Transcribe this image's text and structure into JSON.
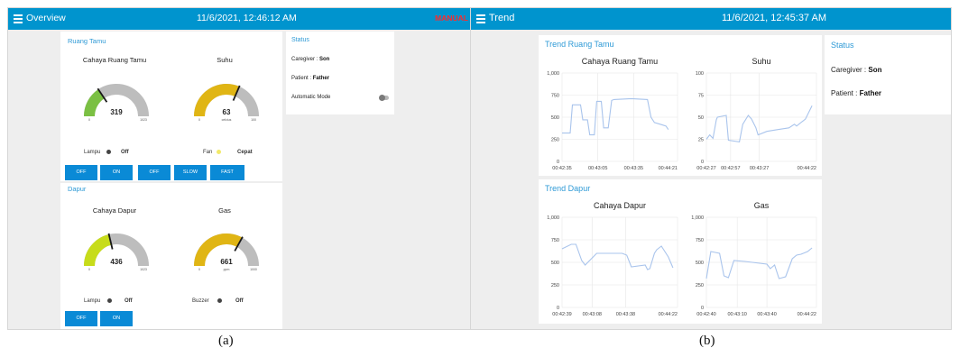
{
  "a": {
    "header": {
      "title": "Overview",
      "time": "11/6/2021, 12:46:12 AM",
      "mode": "MANUAL"
    },
    "ruang_tamu": {
      "group_title": "Ruang Tamu",
      "gauges": [
        {
          "title": "Cahaya Ruang Tamu",
          "value": 319,
          "min": 0,
          "max": 1023,
          "min_label": "0",
          "max_label": "1023",
          "unit": "",
          "color": "#7bc043"
        },
        {
          "title": "Suhu",
          "value": 63,
          "min": 0,
          "max": 100,
          "min_label": "0",
          "max_label": "100",
          "unit": "celcius",
          "color": "#e0b514"
        }
      ],
      "lampu": {
        "label": "Lampu",
        "state": "Off"
      },
      "fan": {
        "label": "Fan",
        "state": "Cepat"
      },
      "buttons": [
        "OFF",
        "ON",
        "OFF",
        "SLOW",
        "FAST"
      ]
    },
    "dapur": {
      "group_title": "Dapur",
      "gauges": [
        {
          "title": "Cahaya Dapur",
          "value": 436,
          "min": 0,
          "max": 1023,
          "min_label": "0",
          "max_label": "1023",
          "unit": "",
          "color": "#c7dc1a"
        },
        {
          "title": "Gas",
          "value": 661,
          "min": 0,
          "max": 1000,
          "min_label": "0",
          "max_label": "1000",
          "unit": "ppm",
          "color": "#e0b514"
        }
      ],
      "lampu": {
        "label": "Lampu",
        "state": "Off"
      },
      "buzzer": {
        "label": "Buzzer",
        "state": "Off"
      },
      "buttons": [
        "OFF",
        "ON"
      ]
    },
    "status": {
      "title": "Status",
      "caregiver_label": "Caregiver :",
      "caregiver": "Son",
      "patient_label": "Patient :",
      "patient": "Father",
      "auto_mode_label": "Automatic Mode"
    },
    "caption": "(a)"
  },
  "b": {
    "header": {
      "title": "Trend",
      "time": "11/6/2021, 12:45:37 AM"
    },
    "trend_ruang_tamu": "Trend Ruang Tamu",
    "trend_dapur": "Trend Dapur",
    "status": {
      "title": "Status",
      "caregiver_label": "Caregiver :",
      "caregiver": "Son",
      "patient_label": "Patient :",
      "patient": "Father"
    },
    "caption": "(b)"
  },
  "colors": {
    "header": "#0094ce",
    "accent": "#2e9ad6",
    "button": "#0a8ad6",
    "line": "#a9c4ec",
    "manual": "#ff2a2a"
  },
  "chart_data": [
    {
      "type": "line",
      "title": "Cahaya Ruang Tamu",
      "ylim": [
        0,
        1000
      ],
      "yticks": [
        "0",
        "250",
        "500",
        "750",
        "1,000"
      ],
      "xticks": [
        "00:42:35",
        "00:43:05",
        "00:43:35",
        "00:44:21"
      ],
      "x_positions": [
        0,
        0.31,
        0.62,
        1
      ],
      "series": [
        {
          "x": [
            0,
            0.07,
            0.09,
            0.16,
            0.18,
            0.22,
            0.24,
            0.28,
            0.3,
            0.34,
            0.36,
            0.4,
            0.43,
            0.45,
            0.6,
            0.74,
            0.77,
            0.8,
            0.85,
            0.9,
            0.92
          ],
          "values": [
            320,
            320,
            640,
            640,
            470,
            470,
            300,
            300,
            680,
            680,
            380,
            380,
            690,
            700,
            710,
            700,
            500,
            440,
            420,
            400,
            360
          ]
        }
      ]
    },
    {
      "type": "line",
      "title": "Suhu",
      "ylim": [
        0,
        100
      ],
      "yticks": [
        "0",
        "25",
        "50",
        "75",
        "100"
      ],
      "xticks": [
        "00:42:27",
        "00:42:57",
        "00:43:27",
        "00:44:22"
      ],
      "x_positions": [
        0,
        0.22,
        0.48,
        1
      ],
      "series": [
        {
          "x": [
            0,
            0.03,
            0.06,
            0.09,
            0.1,
            0.18,
            0.2,
            0.3,
            0.33,
            0.38,
            0.41,
            0.45,
            0.47,
            0.55,
            0.65,
            0.75,
            0.8,
            0.82,
            0.9,
            0.96
          ],
          "values": [
            25,
            30,
            26,
            47,
            50,
            52,
            24,
            22,
            42,
            52,
            48,
            38,
            30,
            34,
            36,
            38,
            42,
            40,
            48,
            63
          ]
        }
      ]
    },
    {
      "type": "line",
      "title": "Cahaya Dapur",
      "ylim": [
        0,
        1000
      ],
      "yticks": [
        "0",
        "250",
        "500",
        "750",
        "1,000"
      ],
      "xticks": [
        "00:42:39",
        "00:43:08",
        "00:43:38",
        "00:44:22"
      ],
      "x_positions": [
        0,
        0.26,
        0.55,
        1
      ],
      "series": [
        {
          "x": [
            0,
            0.08,
            0.12,
            0.17,
            0.2,
            0.3,
            0.52,
            0.56,
            0.6,
            0.72,
            0.74,
            0.76,
            0.8,
            0.82,
            0.86,
            0.92,
            0.96
          ],
          "values": [
            650,
            700,
            700,
            520,
            470,
            600,
            600,
            580,
            450,
            470,
            420,
            430,
            600,
            640,
            680,
            560,
            440
          ]
        }
      ]
    },
    {
      "type": "line",
      "title": "Gas",
      "ylim": [
        0,
        1000
      ],
      "yticks": [
        "0",
        "250",
        "500",
        "750",
        "1,000"
      ],
      "xticks": [
        "00:42:40",
        "00:43:10",
        "00:43:40",
        "00:44:22"
      ],
      "x_positions": [
        0,
        0.28,
        0.55,
        1
      ],
      "series": [
        {
          "x": [
            0,
            0.04,
            0.08,
            0.12,
            0.16,
            0.2,
            0.25,
            0.35,
            0.55,
            0.58,
            0.62,
            0.66,
            0.72,
            0.78,
            0.82,
            0.86,
            0.92,
            0.96
          ],
          "values": [
            320,
            620,
            610,
            600,
            350,
            330,
            520,
            510,
            480,
            430,
            470,
            320,
            340,
            540,
            580,
            590,
            620,
            660
          ]
        }
      ]
    }
  ]
}
